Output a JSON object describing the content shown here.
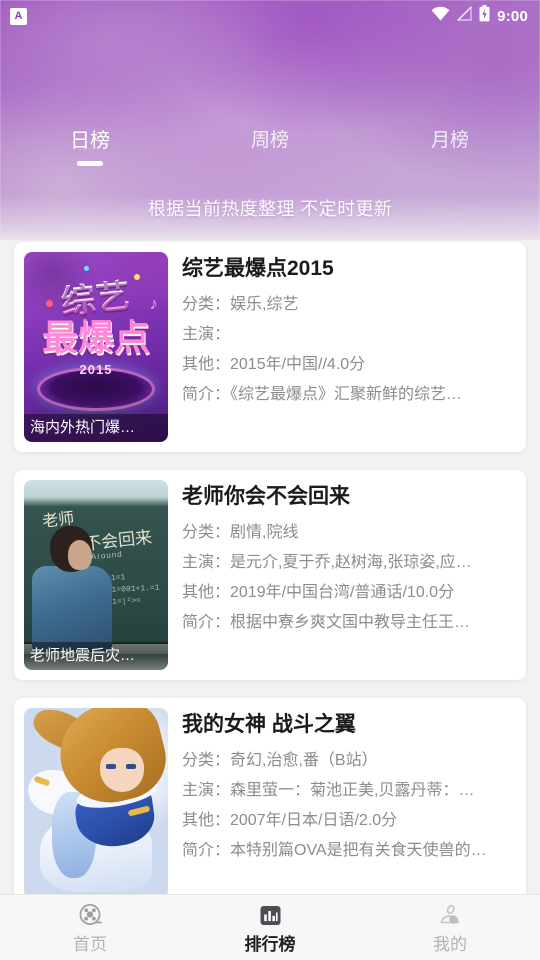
{
  "statusbar": {
    "notification_icon": "app-notification-icon",
    "notification_glyph": "A",
    "wifi_icon": "wifi-icon",
    "signal_icon": "signal-none-icon",
    "battery_icon": "battery-charging-icon",
    "time": "9:00"
  },
  "header": {
    "tabs": [
      {
        "label": "日榜",
        "active": true
      },
      {
        "label": "周榜",
        "active": false
      },
      {
        "label": "月榜",
        "active": false
      }
    ],
    "subtitle": "根据当前热度整理 不定时更新",
    "accent": "#a55cc6",
    "gradient_start": "#9e55c0",
    "gradient_end": "#cbb2db"
  },
  "labels": {
    "category": "分类：",
    "starring": "主演：",
    "other": "其他：",
    "summary": "简介："
  },
  "list": [
    {
      "title": "综艺最爆点2015",
      "category": "分类：娱乐,综艺",
      "starring": "主演：",
      "other": "其他：2015年/中国//4.0分",
      "summary": "简介：《综艺最爆点》汇聚新鲜的综艺…",
      "poster": {
        "caption": "海内外热门爆…",
        "line1": "综艺",
        "line2": "最爆点",
        "line3": "2015"
      }
    },
    {
      "title": "老师你会不会回来",
      "category": "分类：剧情,院线",
      "starring": "主演：是元介,夏于乔,赵树海,张琼姿,应…",
      "other": "其他：2019年/中国台湾/普通话/10.0分",
      "summary": "简介：根据中寮乡爽文国中教导主任王…",
      "poster": {
        "caption": "老师地震后灾…",
        "line1": "老师",
        "line2": "你会不会回来",
        "line3": "Turn Around"
      }
    },
    {
      "title": "我的女神 战斗之翼",
      "category": "分类：奇幻,治愈,番（B站）",
      "starring": "主演：森里萤一：菊池正美,贝露丹蒂：…",
      "other": "其他：2007年/日本/日语/2.0分",
      "summary": "简介：本特别篇OVA是把有关食天使兽的…",
      "poster": {
        "caption": "",
        "line1": "",
        "line2": "",
        "line3": ""
      }
    }
  ],
  "bottomnav": [
    {
      "label": "首页",
      "icon": "film-reel-icon",
      "active": false
    },
    {
      "label": "排行榜",
      "icon": "bar-chart-icon",
      "active": true
    },
    {
      "label": "我的",
      "icon": "person-icon",
      "active": false
    }
  ]
}
